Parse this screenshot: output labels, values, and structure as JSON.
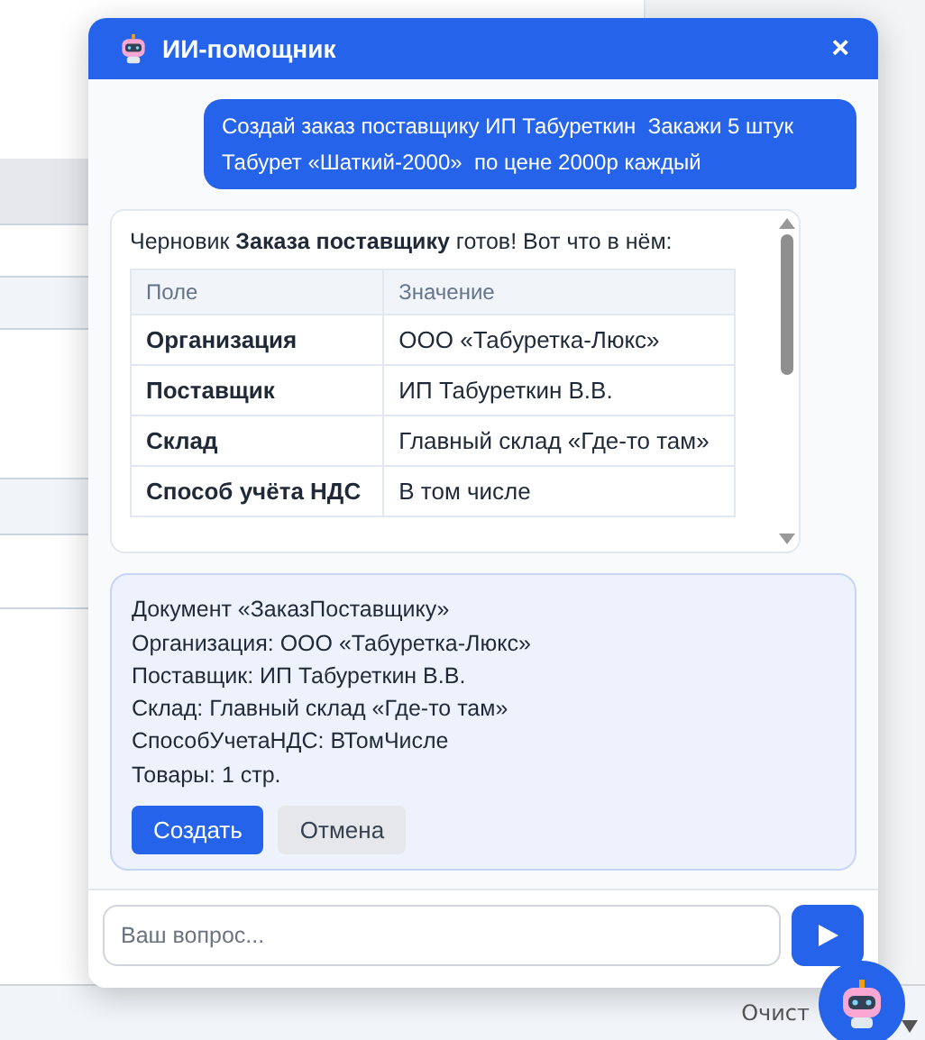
{
  "chat": {
    "title": "ИИ-помощник",
    "close": "×",
    "messages": [
      {
        "kind": "user",
        "text": "Создай заказ поставщику ИП Табуреткин  Закажи 5 штук Табурет «Шаткий-2000»  по цене 2000р каждый"
      },
      {
        "kind": "bot",
        "text": "Черновик **Заказа поставщику** готов! Вот что в нём:",
        "table": {
          "columns": [
            "Поле",
            "Значение"
          ],
          "rows": [
            [
              "Организация",
              "ООО «Табуретка-Люкс»"
            ],
            [
              "Поставщик",
              "ИП Табуреткин В.В."
            ],
            [
              "Склад",
              "Главный склад «Где-то там»"
            ],
            [
              "Способ учёта НДС",
              "В том числе"
            ]
          ]
        }
      },
      {
        "kind": "action",
        "lines": [
          "Документ «ЗаказПоставщику»",
          "Организация: ООО «Табуретка-Люкс»",
          "Поставщик: ИП Табуреткин В.В.",
          "Склад: Главный склад «Где-то там»",
          "СпособУчетаНДС: ВТомЧисле",
          "Товары: 1 стр."
        ],
        "buttons": [
          {
            "label": "Создать",
            "kind": "primary"
          },
          {
            "label": "Отмена",
            "kind": "secondary"
          }
        ]
      }
    ],
    "input": {
      "placeholder": "Ваш вопрос..."
    }
  },
  "footer": {
    "text": "Очист"
  }
}
